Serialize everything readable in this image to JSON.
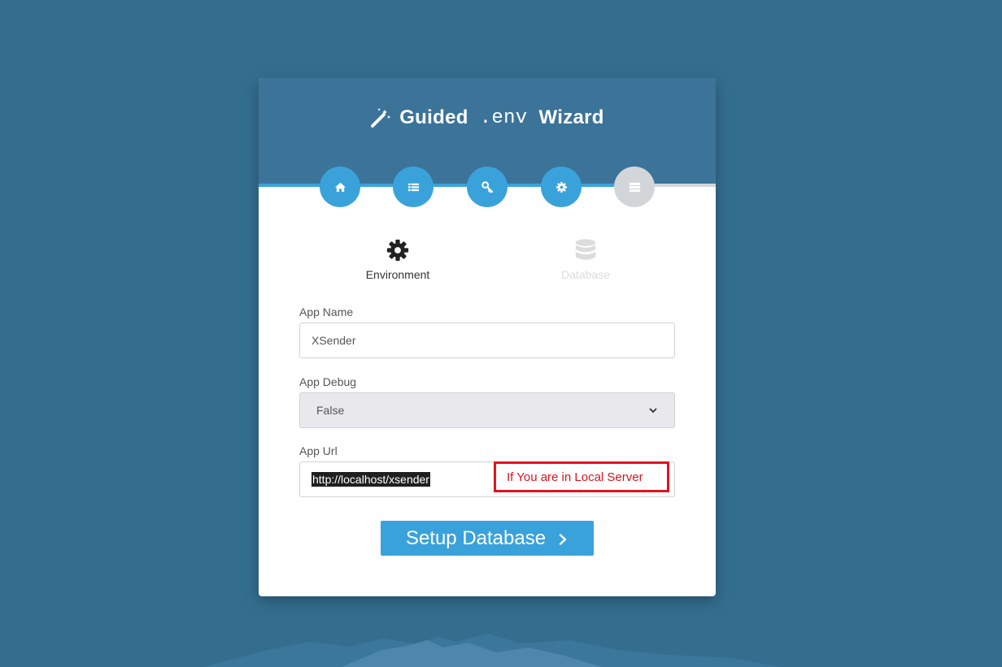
{
  "header": {
    "title_prefix": "Guided",
    "title_mono": ".env",
    "title_suffix": "Wizard"
  },
  "steps": [
    {
      "icon": "home-icon",
      "state": "complete"
    },
    {
      "icon": "list-icon",
      "state": "complete"
    },
    {
      "icon": "key-icon",
      "state": "complete"
    },
    {
      "icon": "gear-icon",
      "state": "active"
    },
    {
      "icon": "server-icon",
      "state": "disabled"
    }
  ],
  "tabs": [
    {
      "label": "Environment",
      "icon": "gear-icon",
      "active": true
    },
    {
      "label": "Database",
      "icon": "database-icon",
      "active": false
    }
  ],
  "form": {
    "app_name": {
      "label": "App Name",
      "value": "XSender"
    },
    "app_debug": {
      "label": "App Debug",
      "selected": "False"
    },
    "app_url": {
      "label": "App Url",
      "value": "http://localhost/xsender"
    }
  },
  "annotation": {
    "text": "If You are in Local Server",
    "color": "#e0141e"
  },
  "submit": {
    "label": "Setup Database"
  },
  "colors": {
    "background": "#346e8f",
    "header": "#3b7399",
    "accent": "#3aa2db",
    "disabled": "#d3d6d9"
  }
}
